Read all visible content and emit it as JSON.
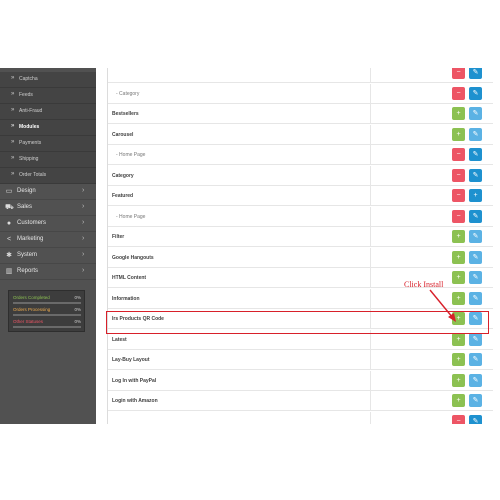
{
  "sidebar": {
    "sub_items": [
      {
        "label": "Captcha",
        "active": false
      },
      {
        "label": "Feeds",
        "active": false
      },
      {
        "label": "Anti-Fraud",
        "active": false
      },
      {
        "label": "Modules",
        "active": true
      },
      {
        "label": "Payments",
        "active": false
      },
      {
        "label": "Shipping",
        "active": false
      },
      {
        "label": "Order Totals",
        "active": false
      }
    ],
    "main_items": [
      {
        "label": "Design",
        "icon": "monitor-icon"
      },
      {
        "label": "Sales",
        "icon": "cart-icon"
      },
      {
        "label": "Customers",
        "icon": "user-icon"
      },
      {
        "label": "Marketing",
        "icon": "share-icon"
      },
      {
        "label": "System",
        "icon": "gear-icon"
      },
      {
        "label": "Reports",
        "icon": "bar-chart-icon"
      }
    ],
    "stats": [
      {
        "label": "Orders Completed",
        "percent": "0%",
        "value": 0,
        "color": "#8cc152"
      },
      {
        "label": "Orders Processing",
        "percent": "0%",
        "value": 0,
        "color": "#f0ad4e"
      },
      {
        "label": "Other Statuses",
        "percent": "0%",
        "value": 0,
        "color": "#ed5565"
      }
    ]
  },
  "modules": [
    {
      "name": "",
      "child": false,
      "buttons": [
        "uninstall",
        "edit"
      ]
    },
    {
      "name": "- Category",
      "child": true,
      "buttons": [
        "delete",
        "edit"
      ]
    },
    {
      "name": "Bestsellers",
      "child": false,
      "buttons": [
        "install",
        "edit"
      ]
    },
    {
      "name": "Carousel",
      "child": false,
      "buttons": [
        "install",
        "edit"
      ]
    },
    {
      "name": "- Home Page",
      "child": true,
      "buttons": [
        "delete",
        "edit"
      ]
    },
    {
      "name": "Category",
      "child": false,
      "buttons": [
        "uninstall",
        "edit"
      ]
    },
    {
      "name": "Featured",
      "child": false,
      "buttons": [
        "uninstall",
        "add"
      ]
    },
    {
      "name": "- Home Page",
      "child": true,
      "buttons": [
        "delete",
        "edit"
      ]
    },
    {
      "name": "Filter",
      "child": false,
      "buttons": [
        "install",
        "edit"
      ]
    },
    {
      "name": "Google Hangouts",
      "child": false,
      "buttons": [
        "install",
        "edit"
      ]
    },
    {
      "name": "HTML Content",
      "child": false,
      "buttons": [
        "install",
        "edit"
      ]
    },
    {
      "name": "Information",
      "child": false,
      "buttons": [
        "install",
        "edit"
      ]
    },
    {
      "name": "Irs Products QR Code",
      "child": false,
      "buttons": [
        "install",
        "edit"
      ]
    },
    {
      "name": "Latest",
      "child": false,
      "buttons": [
        "install",
        "edit"
      ]
    },
    {
      "name": "Lay-Buy Layout",
      "child": false,
      "buttons": [
        "install",
        "edit"
      ]
    },
    {
      "name": "Log In with PayPal",
      "child": false,
      "buttons": [
        "install",
        "edit"
      ]
    },
    {
      "name": "Login with Amazon",
      "child": false,
      "buttons": [
        "install",
        "edit"
      ]
    },
    {
      "name": "",
      "child": false,
      "buttons": [
        "uninstall",
        "edit"
      ]
    }
  ],
  "annotation": {
    "callout_text": "Click Install"
  },
  "colors": {
    "install": "#8cc152",
    "uninstall": "#ed5565",
    "delete": "#ed5565",
    "edit": "#1e91cf",
    "edit_disabled": "#5bb2e4",
    "add": "#1e91cf",
    "highlight": "#d8202a"
  }
}
